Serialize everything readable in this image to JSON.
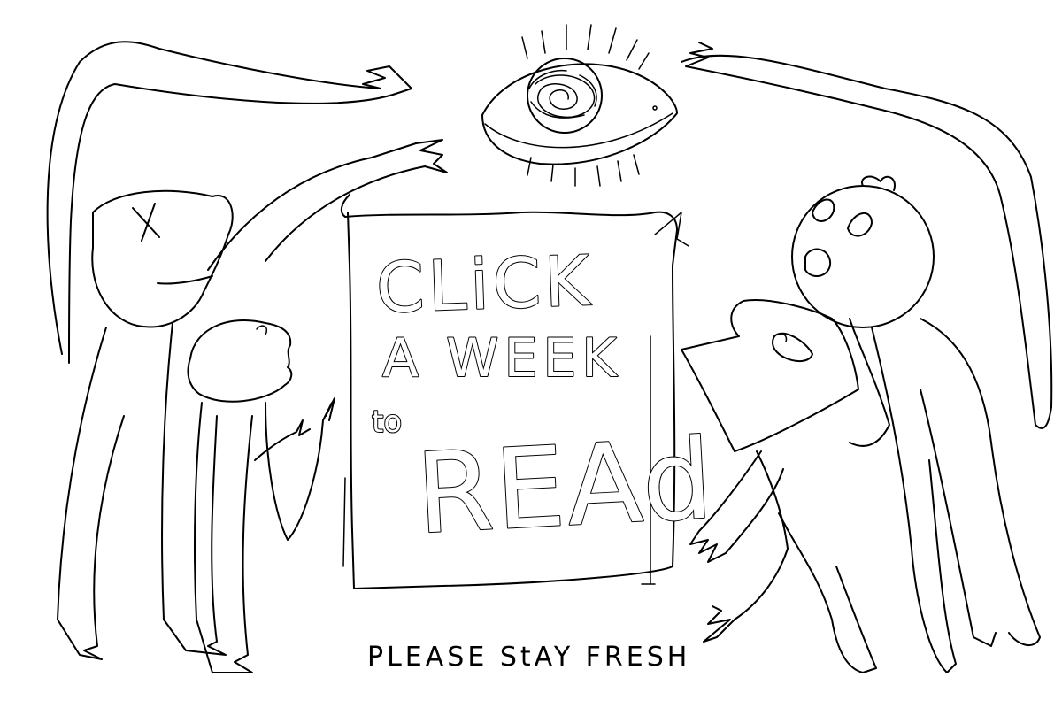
{
  "sign": {
    "line1": "CLiCK",
    "line2": "A WEEK",
    "line3_small": "to",
    "line3_big": "REAd"
  },
  "caption": "PLEASE StAY FRESH"
}
